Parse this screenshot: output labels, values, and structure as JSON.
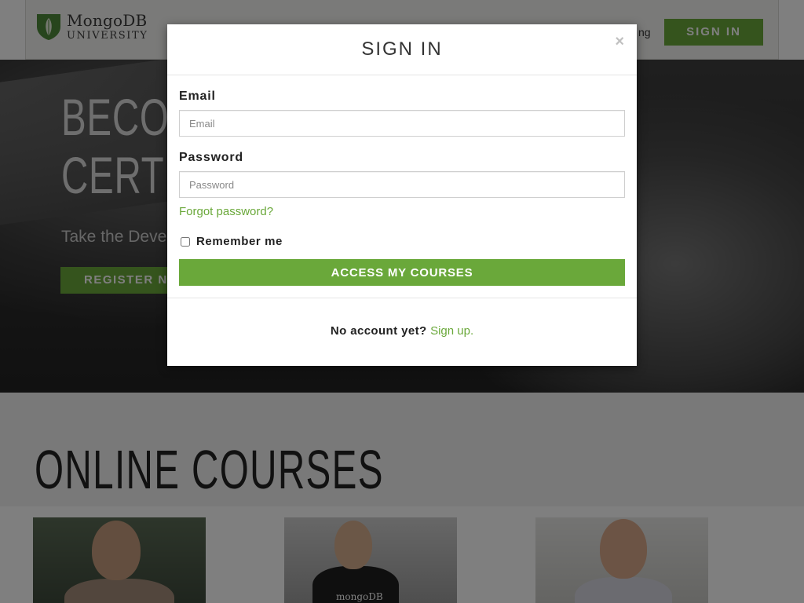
{
  "header": {
    "logo_top": "MongoDB",
    "logo_bottom": "UNIVERSITY",
    "logo_icon": "mongodb-leaf-shield",
    "nav_partial": "ng",
    "sign_in_label": "SIGN IN"
  },
  "hero": {
    "title_line1": "BECOME",
    "title_line2": "CERTIFIED",
    "subtitle": "Take the Developer",
    "register_label": "REGISTER NOW"
  },
  "courses": {
    "title": "ONLINE COURSES",
    "card_shirt_text": "mongoDB"
  },
  "modal": {
    "title": "SIGN IN",
    "close_label": "×",
    "email_label": "Email",
    "email_placeholder": "Email",
    "email_value": "",
    "password_label": "Password",
    "password_placeholder": "Password",
    "password_value": "",
    "forgot_label": "Forgot password?",
    "remember_label": "Remember me",
    "remember_checked": false,
    "submit_label": "ACCESS MY COURSES",
    "footer_text": "No account yet?",
    "signup_label": "Sign up."
  },
  "colors": {
    "accent": "#6aa83a",
    "overlay": "rgba(0,0,0,0.5)",
    "text": "#222222"
  }
}
